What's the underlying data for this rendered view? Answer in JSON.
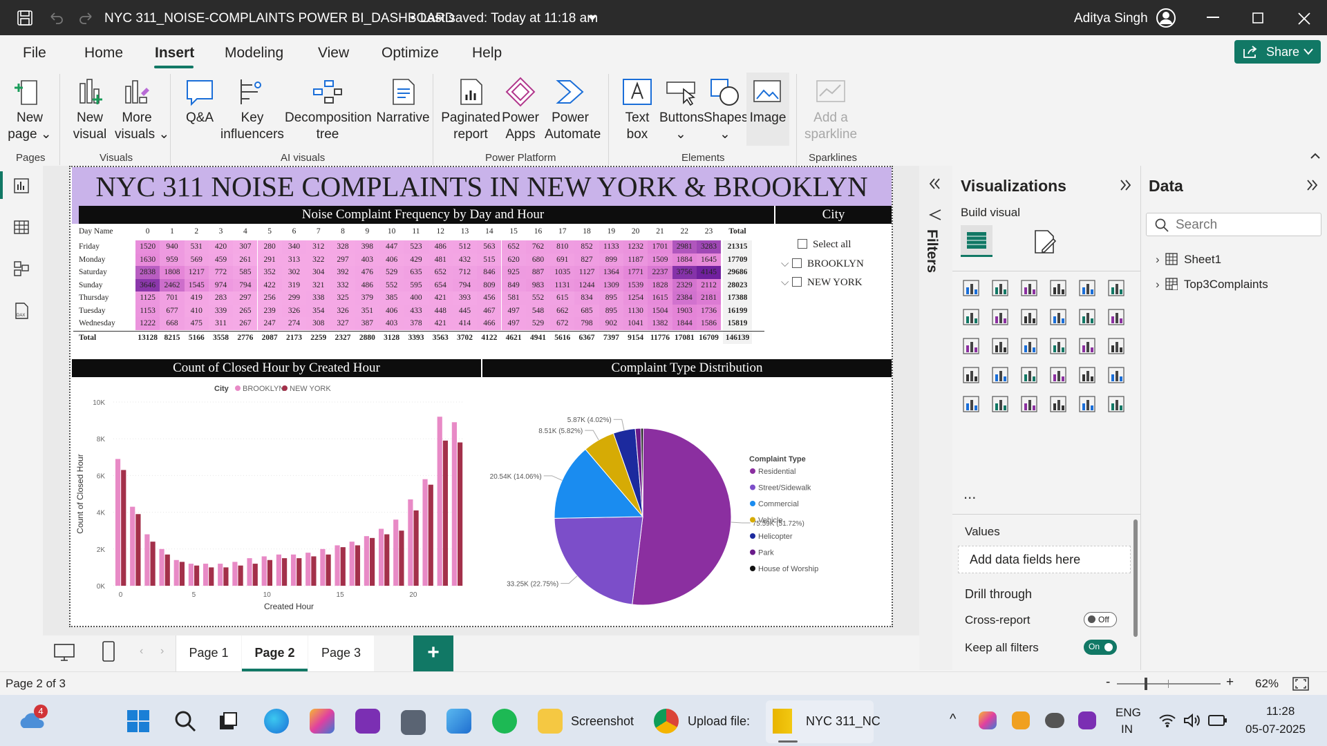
{
  "titlebar": {
    "file_title": "NYC 311_NOISE-COMPLAINTS POWER BI_DASHBOARD",
    "saved_status": "Last saved: Today at 11:18 am",
    "user": "Aditya Singh"
  },
  "menu": {
    "items": [
      "File",
      "Home",
      "Insert",
      "Modeling",
      "View",
      "Optimize",
      "Help"
    ],
    "active": "Insert",
    "share": "Share"
  },
  "ribbon": {
    "buttons": [
      {
        "l1": "New",
        "l2": "page ⌄",
        "icon": "new-page-icon"
      },
      {
        "l1": "New",
        "l2": "visual",
        "icon": "new-visual-icon"
      },
      {
        "l1": "More",
        "l2": "visuals ⌄",
        "icon": "more-visuals-icon"
      },
      {
        "l1": "Q&A",
        "l2": "",
        "icon": "qa-icon"
      },
      {
        "l1": "Key",
        "l2": "influencers",
        "icon": "key-influencers-icon"
      },
      {
        "l1": "Decomposition",
        "l2": "tree",
        "icon": "decomposition-tree-icon"
      },
      {
        "l1": "Narrative",
        "l2": "",
        "icon": "narrative-icon"
      },
      {
        "l1": "Paginated",
        "l2": "report",
        "icon": "paginated-report-icon"
      },
      {
        "l1": "Power",
        "l2": "Apps",
        "icon": "power-apps-icon"
      },
      {
        "l1": "Power",
        "l2": "Automate",
        "icon": "power-automate-icon"
      },
      {
        "l1": "Text",
        "l2": "box",
        "icon": "text-box-icon"
      },
      {
        "l1": "Buttons",
        "l2": "⌄",
        "icon": "buttons-icon"
      },
      {
        "l1": "Shapes",
        "l2": "⌄",
        "icon": "shapes-icon"
      },
      {
        "l1": "Image",
        "l2": "",
        "icon": "image-icon"
      },
      {
        "l1": "Add a",
        "l2": "sparkline",
        "icon": "sparkline-icon"
      }
    ],
    "groups": [
      "Pages",
      "Visuals",
      "AI visuals",
      "Power Platform",
      "Elements",
      "Sparklines"
    ]
  },
  "report": {
    "title": "NYC 311 NOISE COMPLAINTS IN NEW YORK & BROOKLYN",
    "matrix_title": "Noise Complaint Frequency by Day and Hour",
    "city_title": "City",
    "closed_title": "Count of Closed Hour by Created Hour",
    "pie_title": "Complaint Type Distribution"
  },
  "slicer": {
    "select_all": "Select all",
    "options": [
      "BROOKLYN",
      "NEW YORK"
    ]
  },
  "matrix": {
    "corner": "Day Name",
    "total_label": "Total",
    "hours": [
      "0",
      "1",
      "2",
      "3",
      "4",
      "5",
      "6",
      "7",
      "8",
      "9",
      "10",
      "11",
      "12",
      "13",
      "14",
      "15",
      "16",
      "17",
      "18",
      "19",
      "20",
      "21",
      "22",
      "23"
    ],
    "rows": [
      {
        "day": "Friday",
        "values": [
          1520,
          940,
          531,
          420,
          307,
          280,
          340,
          312,
          328,
          398,
          447,
          523,
          486,
          512,
          563,
          652,
          762,
          810,
          852,
          1133,
          1232,
          1701,
          2981,
          3283
        ],
        "total": 21315
      },
      {
        "day": "Monday",
        "values": [
          1630,
          959,
          569,
          459,
          261,
          291,
          313,
          322,
          297,
          403,
          406,
          429,
          481,
          432,
          515,
          620,
          680,
          691,
          827,
          899,
          1187,
          1509,
          1884,
          1645
        ],
        "total": 17709
      },
      {
        "day": "Saturday",
        "values": [
          2838,
          1808,
          1217,
          772,
          585,
          352,
          302,
          304,
          392,
          476,
          529,
          635,
          652,
          712,
          846,
          925,
          887,
          1035,
          1127,
          1364,
          1771,
          2237,
          3756,
          4145
        ],
        "total": 29686
      },
      {
        "day": "Sunday",
        "values": [
          3646,
          2462,
          1545,
          974,
          794,
          422,
          319,
          321,
          332,
          486,
          552,
          595,
          654,
          794,
          809,
          849,
          983,
          1131,
          1244,
          1309,
          1539,
          1828,
          2329,
          2112
        ],
        "total": 28023
      },
      {
        "day": "Thursday",
        "values": [
          1125,
          701,
          419,
          283,
          297,
          256,
          299,
          338,
          325,
          379,
          385,
          400,
          421,
          393,
          456,
          581,
          552,
          615,
          834,
          895,
          1254,
          1615,
          2384,
          2181
        ],
        "total": 17388
      },
      {
        "day": "Tuesday",
        "values": [
          1153,
          677,
          410,
          339,
          265,
          239,
          326,
          354,
          326,
          351,
          406,
          433,
          448,
          445,
          467,
          497,
          548,
          662,
          685,
          895,
          1130,
          1504,
          1903,
          1736
        ],
        "total": 16199
      },
      {
        "day": "Wednesday",
        "values": [
          1222,
          668,
          475,
          311,
          267,
          247,
          274,
          308,
          327,
          387,
          403,
          378,
          421,
          414,
          466,
          497,
          529,
          672,
          798,
          902,
          1041,
          1382,
          1844,
          1586
        ],
        "total": 15819
      }
    ],
    "totals": [
      13128,
      8215,
      5166,
      3558,
      2776,
      2087,
      2173,
      2259,
      2327,
      2880,
      3128,
      3393,
      3563,
      3702,
      4122,
      4621,
      4941,
      5616,
      6367,
      7397,
      9154,
      11776,
      17081,
      16709
    ],
    "grand_total": 146139
  },
  "chart_data": [
    {
      "type": "bar",
      "title": "Count of Closed Hour by Created Hour",
      "xlabel": "Created Hour",
      "ylabel": "Count of Closed Hour",
      "legend_title": "City",
      "x_ticks": [
        "0",
        "5",
        "10",
        "15",
        "20"
      ],
      "y_ticks": [
        "0K",
        "2K",
        "4K",
        "6K",
        "8K",
        "10K"
      ],
      "ylim": [
        0,
        10000
      ],
      "categories": [
        0,
        1,
        2,
        3,
        4,
        5,
        6,
        7,
        8,
        9,
        10,
        11,
        12,
        13,
        14,
        15,
        16,
        17,
        18,
        19,
        20,
        21,
        22,
        23
      ],
      "series": [
        {
          "name": "BROOKLYN",
          "color": "#e88ac6",
          "values": [
            6900,
            4300,
            2800,
            2000,
            1400,
            1200,
            1200,
            1200,
            1300,
            1500,
            1600,
            1700,
            1700,
            1800,
            2000,
            2200,
            2400,
            2700,
            3100,
            3600,
            4700,
            5800,
            9200,
            8900
          ]
        },
        {
          "name": "NEW YORK",
          "color": "#a3304a",
          "values": [
            6300,
            3900,
            2400,
            1700,
            1300,
            1100,
            1000,
            1000,
            1100,
            1200,
            1400,
            1500,
            1500,
            1600,
            1700,
            2100,
            2200,
            2600,
            2800,
            3000,
            4100,
            5500,
            7900,
            7800
          ]
        }
      ]
    },
    {
      "type": "pie",
      "title": "Complaint Type Distribution",
      "legend_title": "Complaint Type",
      "labels": [
        "Residential",
        "Street/Sidewalk",
        "Commercial",
        "Vehicle",
        "Helicopter",
        "Park",
        "House of Worship"
      ],
      "values": [
        75590,
        33250,
        20540,
        8510,
        5870,
        1500,
        600
      ],
      "data_labels": [
        "75.59K (51.72%)",
        "33.25K (22.75%)",
        "20.54K (14.06%)",
        "8.51K (5.82%)",
        "5.87K (4.02%)",
        "",
        ""
      ],
      "colors": [
        "#8b2fa0",
        "#7c4ec9",
        "#1a8cf0",
        "#d6ab05",
        "#1c2a9e",
        "#6a1b8a",
        "#111111"
      ]
    }
  ],
  "panels": {
    "filters": "Filters",
    "visualizations": "Visualizations",
    "build_visual": "Build visual",
    "values": "Values",
    "add_fields": "Add data fields here",
    "drill_through": "Drill through",
    "cross_report": "Cross-report",
    "cross_report_state": "Off",
    "keep_filters": "Keep all filters",
    "keep_filters_state": "On",
    "more": "...",
    "data": "Data",
    "search_placeholder": "Search",
    "tables": [
      "Sheet1",
      "Top3Complaints"
    ]
  },
  "pages": {
    "tabs": [
      "Page 1",
      "Page 2",
      "Page 3"
    ],
    "active": "Page 2",
    "add": "+"
  },
  "status": {
    "page_info": "Page 2 of 3",
    "zoom": "62%"
  },
  "taskbar": {
    "apps": [
      "Screenshot",
      "Upload file:",
      "NYC 311_NC"
    ],
    "lang1": "ENG",
    "lang2": "IN",
    "time": "11:28",
    "date": "05-07-2025",
    "weather_badge": "4"
  }
}
